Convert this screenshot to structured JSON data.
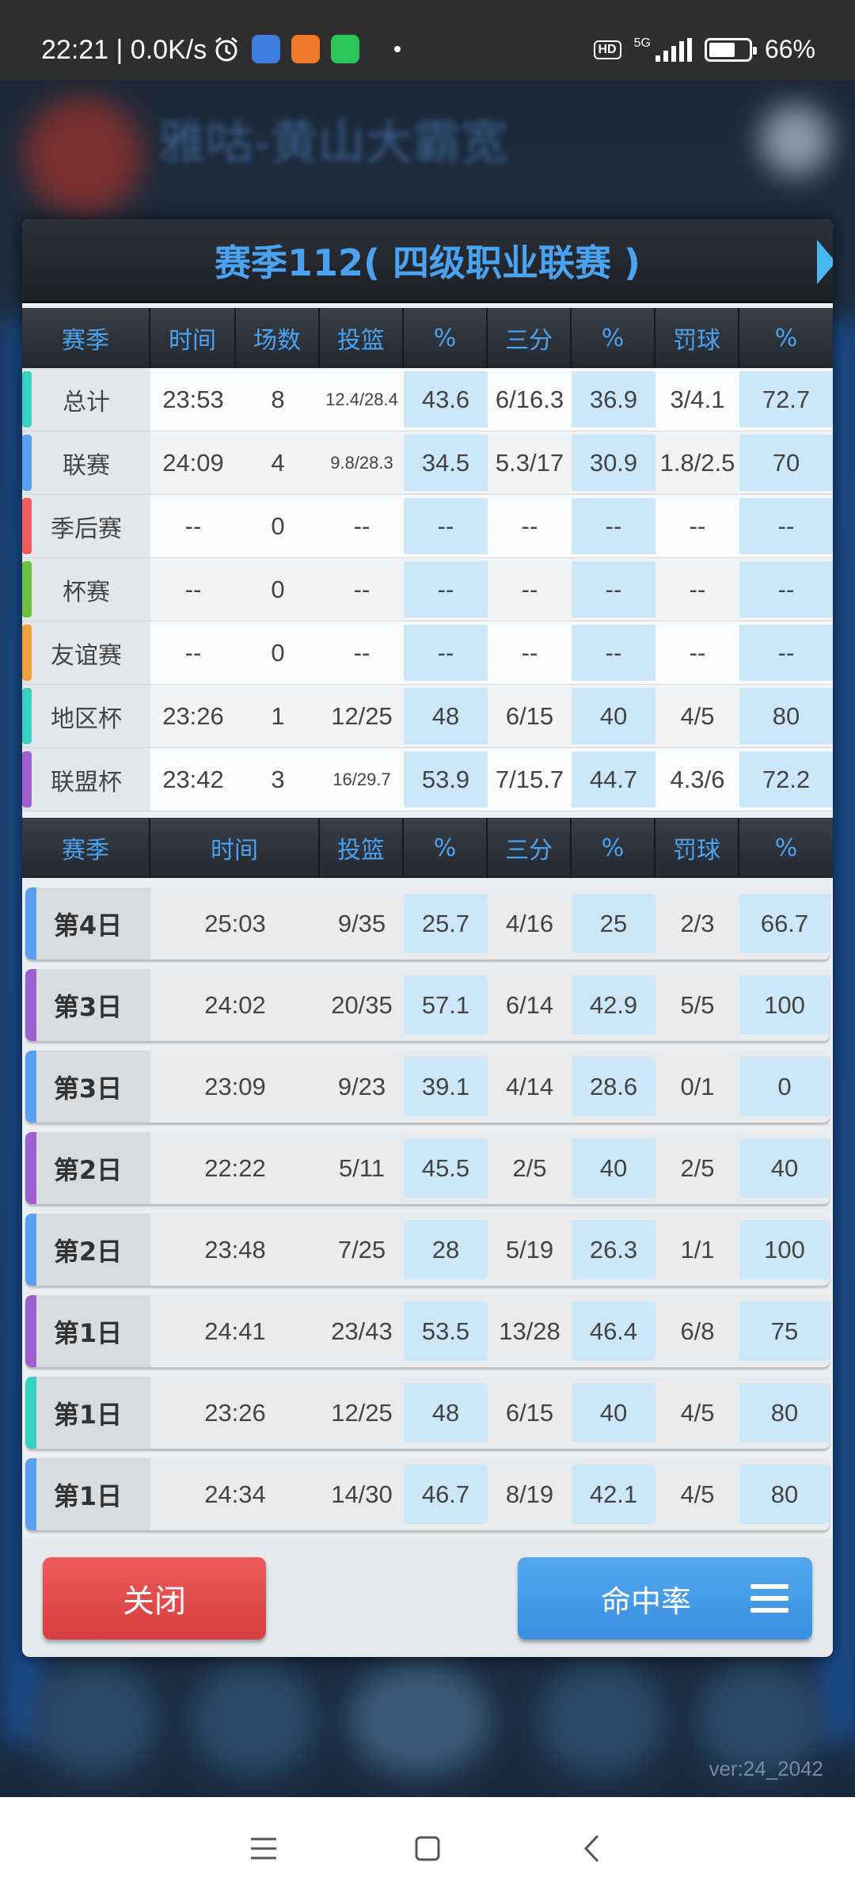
{
  "status_bar": {
    "time": "22:21 | 0.0K/s",
    "network": "5G",
    "battery": "66%",
    "battery_level": 0.66
  },
  "background": {
    "title": "雅咕-黄山大霸宽",
    "version": "ver:24_2042"
  },
  "dialog": {
    "title": "赛季112( 四级职业联赛 )",
    "table1": {
      "headers": [
        "赛季",
        "时间",
        "场数",
        "投篮",
        "%",
        "三分",
        "%",
        "罚球",
        "%"
      ],
      "rows": [
        {
          "label": "总计",
          "accent": "#3ad0c0",
          "time": "23:53",
          "games": "8",
          "fg": "12.4/28.4",
          "fg_pct": "43.6",
          "three": "6/16.3",
          "three_pct": "36.9",
          "ft": "3/4.1",
          "ft_pct": "72.7"
        },
        {
          "label": "联赛",
          "accent": "#5aa0f0",
          "time": "24:09",
          "games": "4",
          "fg": "9.8/28.3",
          "fg_pct": "34.5",
          "three": "5.3/17",
          "three_pct": "30.9",
          "ft": "1.8/2.5",
          "ft_pct": "70"
        },
        {
          "label": "季后赛",
          "accent": "#f05a5a",
          "time": "--",
          "games": "0",
          "fg": "--",
          "fg_pct": "--",
          "three": "--",
          "three_pct": "--",
          "ft": "--",
          "ft_pct": "--"
        },
        {
          "label": "杯赛",
          "accent": "#6ac040",
          "time": "--",
          "games": "0",
          "fg": "--",
          "fg_pct": "--",
          "three": "--",
          "three_pct": "--",
          "ft": "--",
          "ft_pct": "--"
        },
        {
          "label": "友谊赛",
          "accent": "#f0a040",
          "time": "--",
          "games": "0",
          "fg": "--",
          "fg_pct": "--",
          "three": "--",
          "three_pct": "--",
          "ft": "--",
          "ft_pct": "--"
        },
        {
          "label": "地区杯",
          "accent": "#3ad0c0",
          "time": "23:26",
          "games": "1",
          "fg": "12/25",
          "fg_pct": "48",
          "three": "6/15",
          "three_pct": "40",
          "ft": "4/5",
          "ft_pct": "80"
        },
        {
          "label": "联盟杯",
          "accent": "#a060d0",
          "time": "23:42",
          "games": "3",
          "fg": "16/29.7",
          "fg_pct": "53.9",
          "three": "7/15.7",
          "three_pct": "44.7",
          "ft": "4.3/6",
          "ft_pct": "72.2"
        }
      ]
    },
    "table2": {
      "headers": [
        "赛季",
        "时间",
        "投篮",
        "%",
        "三分",
        "%",
        "罚球",
        "%"
      ],
      "rows": [
        {
          "label": "第4日",
          "accent": "#5aa0f0",
          "time": "25:03",
          "fg": "9/35",
          "fg_pct": "25.7",
          "three": "4/16",
          "three_pct": "25",
          "ft": "2/3",
          "ft_pct": "66.7"
        },
        {
          "label": "第3日",
          "accent": "#a060d0",
          "time": "24:02",
          "fg": "20/35",
          "fg_pct": "57.1",
          "three": "6/14",
          "three_pct": "42.9",
          "ft": "5/5",
          "ft_pct": "100"
        },
        {
          "label": "第3日",
          "accent": "#5aa0f0",
          "time": "23:09",
          "fg": "9/23",
          "fg_pct": "39.1",
          "three": "4/14",
          "three_pct": "28.6",
          "ft": "0/1",
          "ft_pct": "0"
        },
        {
          "label": "第2日",
          "accent": "#a060d0",
          "time": "22:22",
          "fg": "5/11",
          "fg_pct": "45.5",
          "three": "2/5",
          "three_pct": "40",
          "ft": "2/5",
          "ft_pct": "40"
        },
        {
          "label": "第2日",
          "accent": "#5aa0f0",
          "time": "23:48",
          "fg": "7/25",
          "fg_pct": "28",
          "three": "5/19",
          "three_pct": "26.3",
          "ft": "1/1",
          "ft_pct": "100"
        },
        {
          "label": "第1日",
          "accent": "#a060d0",
          "time": "24:41",
          "fg": "23/43",
          "fg_pct": "53.5",
          "three": "13/28",
          "three_pct": "46.4",
          "ft": "6/8",
          "ft_pct": "75"
        },
        {
          "label": "第1日",
          "accent": "#3ad0c0",
          "time": "23:26",
          "fg": "12/25",
          "fg_pct": "48",
          "three": "6/15",
          "three_pct": "40",
          "ft": "4/5",
          "ft_pct": "80"
        },
        {
          "label": "第1日",
          "accent": "#5aa0f0",
          "time": "24:34",
          "fg": "14/30",
          "fg_pct": "46.7",
          "three": "8/19",
          "three_pct": "42.1",
          "ft": "4/5",
          "ft_pct": "80"
        }
      ]
    },
    "close_label": "关闭",
    "rate_label": "命中率"
  },
  "icons": {
    "menu": "menu-icon",
    "next": "chevron-right-icon"
  },
  "colors": {
    "accent_blue": "#4aa3f0",
    "close_red": "#e04848",
    "pct_cell": "#cce8f8"
  }
}
